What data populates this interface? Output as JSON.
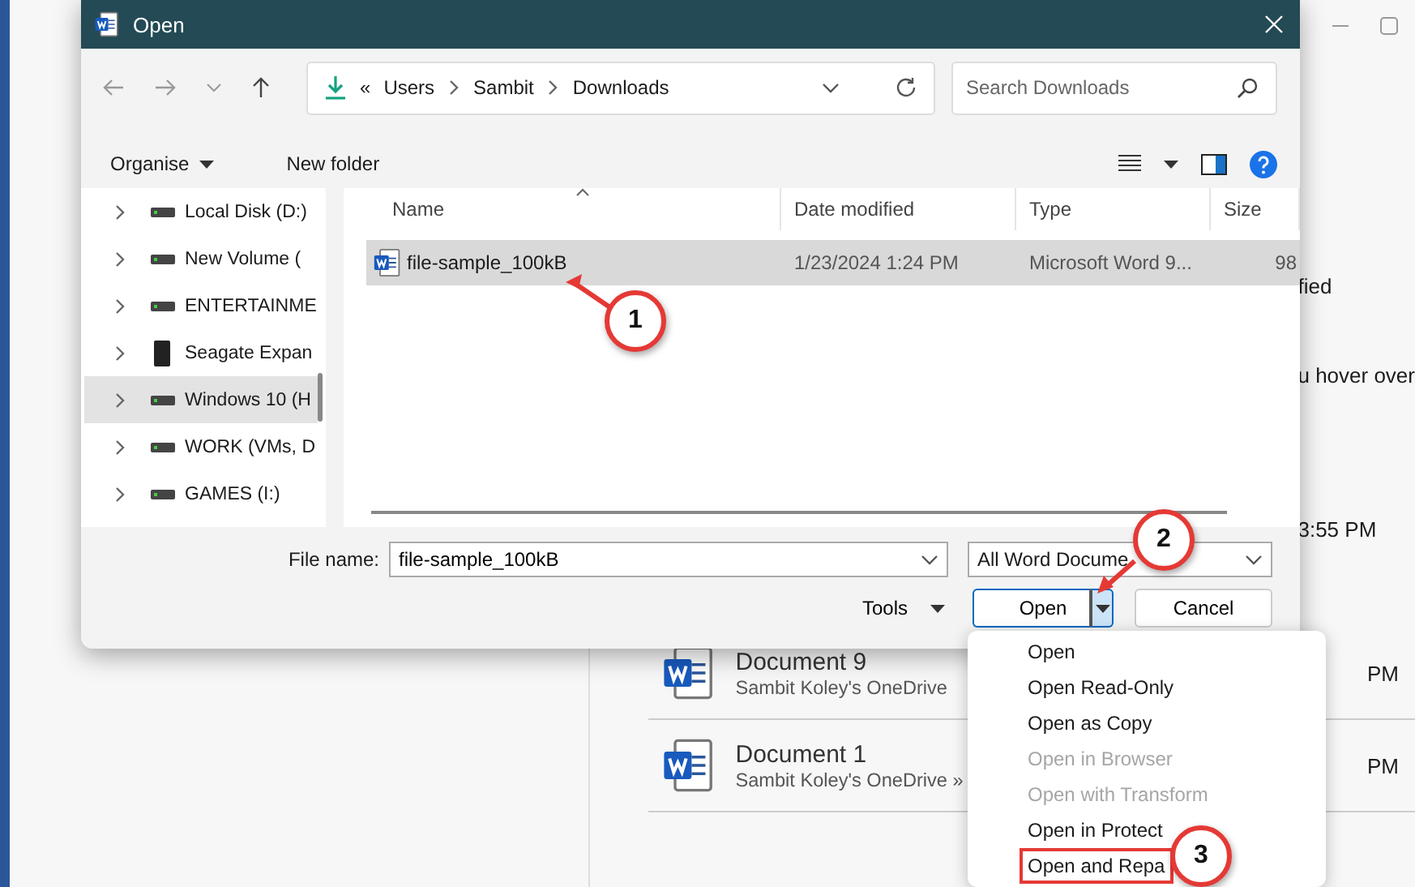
{
  "background_app": {
    "side_texts": [
      "fied",
      "u hover over",
      "3:55 PM"
    ],
    "documents": [
      {
        "title": "Document 9",
        "location": "Sambit Koley's OneDrive",
        "time": "PM"
      },
      {
        "title": "Document 1",
        "location": "Sambit Koley's OneDrive »",
        "time": "PM"
      }
    ]
  },
  "dialog": {
    "title": "Open",
    "address_bar": {
      "overflow": "«",
      "path": [
        "Users",
        "Sambit",
        "Downloads"
      ]
    },
    "search": {
      "placeholder": "Search Downloads"
    },
    "toolbar": {
      "organise": "Organise",
      "new_folder": "New folder"
    },
    "nav_pane": [
      {
        "label": "Local Disk (D:)",
        "kind": "drive",
        "selected": false
      },
      {
        "label": "New Volume (",
        "kind": "drive",
        "selected": false
      },
      {
        "label": "ENTERTAINME",
        "kind": "drive",
        "selected": false
      },
      {
        "label": "Seagate Expan",
        "kind": "external",
        "selected": false
      },
      {
        "label": "Windows 10 (H",
        "kind": "drive",
        "selected": true
      },
      {
        "label": "WORK (VMs, D",
        "kind": "drive",
        "selected": false
      },
      {
        "label": "GAMES (I:)",
        "kind": "drive",
        "selected": false
      }
    ],
    "columns": [
      "Name",
      "Date modified",
      "Type",
      "Size"
    ],
    "files": [
      {
        "name": "file-sample_100kB",
        "date": "1/23/2024 1:24 PM",
        "type": "Microsoft Word 9...",
        "size": "98",
        "selected": true
      }
    ],
    "file_name": {
      "label": "File name:",
      "value": "file-sample_100kB"
    },
    "file_type": {
      "value": "All Word Docume"
    },
    "tools": "Tools",
    "open_button": "Open",
    "cancel_button": "Cancel"
  },
  "open_menu": [
    {
      "label": "Open",
      "disabled": false,
      "highlighted": false
    },
    {
      "label": "Open Read-Only",
      "disabled": false,
      "highlighted": false
    },
    {
      "label": "Open as Copy",
      "disabled": false,
      "highlighted": false
    },
    {
      "label": "Open in Browser",
      "disabled": true,
      "highlighted": false
    },
    {
      "label": "Open with Transform",
      "disabled": true,
      "highlighted": false
    },
    {
      "label": "Open in Protect",
      "disabled": false,
      "highlighted": false
    },
    {
      "label": "Open and Repa",
      "disabled": false,
      "highlighted": true
    }
  ],
  "annotations": [
    {
      "label": "1"
    },
    {
      "label": "2"
    },
    {
      "label": "3"
    }
  ]
}
